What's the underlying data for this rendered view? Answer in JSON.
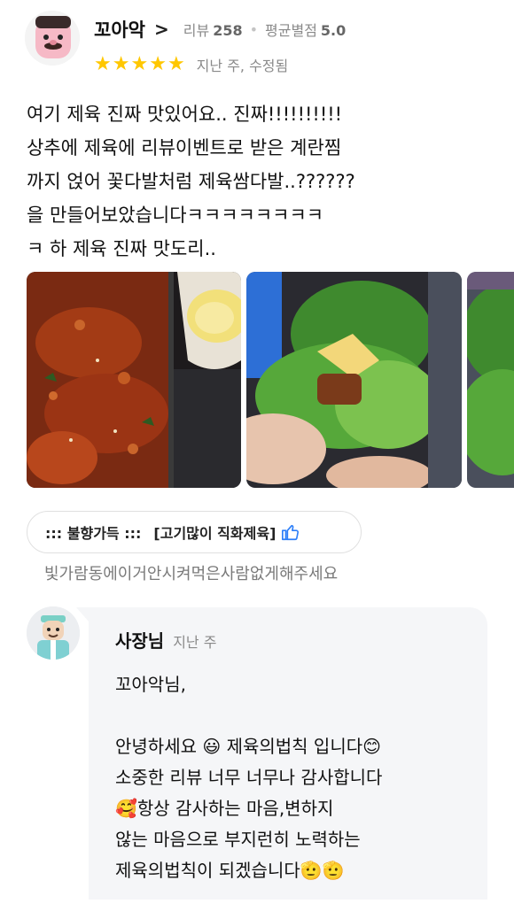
{
  "review": {
    "author": "꼬아악",
    "stats": {
      "review_label": "리뷰",
      "review_count": "258",
      "avg_label": "평균별점",
      "avg_value": "5.0"
    },
    "rating": 5,
    "date": "지난 주, 수정됨",
    "text": "여기 제육 진짜 맛있어요.. 진짜!!!!!!!!!!\n상추에 제육에 리뷰이벤트로 받은 계란찜\n까지 얹어 꽃다발처럼 제육쌈다발..??????\n을 만들어보았습니다ㅋㅋㅋㅋㅋㅋㅋㅋ\nㅋ 하 제육 진짜 맛도리..",
    "menu_tag": {
      "prefix": "::: 불향가득 :::",
      "item": "[고기많이 직화제육]"
    },
    "order_note": "빛가람동에이거안시켜먹은사람없게해주세요"
  },
  "owner_reply": {
    "name": "사장님",
    "date": "지난 주",
    "text": "꼬아악님,\n\n안녕하세요 😃 제육의법칙 입니다😊\n소중한 리뷰 너무 너무나 감사합니다\n🥰항상 감사하는 마음,변하지\n않는 마음으로 부지런히 노력하는\n제육의법칙이 되겠습니다🫡🫡"
  },
  "colors": {
    "star": "#ffc700",
    "thumb_accent": "#2d7ff9",
    "reply_bg": "#f5f6f8"
  },
  "icons": [
    "avatar",
    "chevron-right-icon",
    "star-icon",
    "food-photo",
    "thumbs-up-icon",
    "owner-avatar"
  ]
}
